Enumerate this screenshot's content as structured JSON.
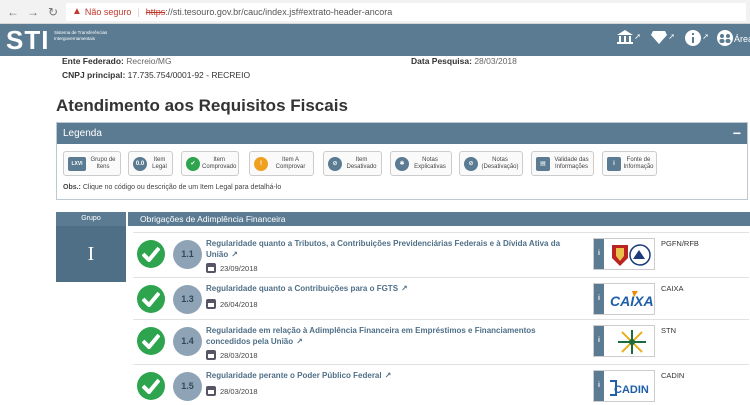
{
  "browser": {
    "security_label": "Não seguro",
    "url_scheme": "https",
    "url_rest": "://sti.tesouro.gov.br/cauc/index.jsf#extrato-header-ancora"
  },
  "app": {
    "logo": "STI",
    "logo_sub": "Sistema de Transferências Intergovernamentais",
    "area_label": "Área"
  },
  "entity": {
    "ente_label": "Ente Federado:",
    "ente_value": "Recreio/MG",
    "data_label": "Data Pesquisa:",
    "data_value": "28/03/2018",
    "cnpj_label": "CNPJ principal:",
    "cnpj_value": "17.735.754/0001-92 - RECREIO"
  },
  "page_title": "Atendimento aos Requisitos Fiscais",
  "legend": {
    "title": "Legenda",
    "collapse": "−",
    "items": [
      {
        "icon": "LXVI",
        "label": "Grupo de Itens",
        "color": "#5b7b92"
      },
      {
        "icon": "0.0",
        "label": "Item Legal",
        "color": "#5b7b92"
      },
      {
        "icon": "✔",
        "label": "Item Comprovado",
        "color": "#2fa44f"
      },
      {
        "icon": "!",
        "label": "Item A Comprovar",
        "color": "#f0a020"
      },
      {
        "icon": "⊘",
        "label": "Item Desativado",
        "color": "#5b7b92"
      },
      {
        "icon": "✱",
        "label": "Notas Explicativas",
        "color": "#5b7b92"
      },
      {
        "icon": "⊘",
        "label": "Notas (Desativação)",
        "color": "#5b7b92"
      },
      {
        "icon": "▤",
        "label": "Validade das Informações",
        "color": "#5b7b92"
      },
      {
        "icon": "i",
        "label": "Fonte de Informação",
        "color": "#5b7b92"
      }
    ],
    "obs_label": "Obs.:",
    "obs_text": "Clique no código ou descrição de um Item Legal para detalhá-lo"
  },
  "grupo": {
    "header": "Grupo",
    "value": "I",
    "section_title": "Obrigações de Adimplência Financeira"
  },
  "rows": [
    {
      "code": "1.1",
      "title": "Regularidade quanto a Tributos, a Contribuições Previdenciárias Federais e à Dívida Ativa da União",
      "date": "23/09/2018",
      "source": "PGFN/RFB",
      "status_color": "#2fa44f"
    },
    {
      "code": "1.3",
      "title": "Regularidade quanto a Contribuições para o FGTS",
      "date": "26/04/2018",
      "source": "CAIXA",
      "status_color": "#2fa44f"
    },
    {
      "code": "1.4",
      "title": "Regularidade em relação à Adimplência Financeira em Empréstimos e Financiamentos concedidos pela União",
      "date": "28/03/2018",
      "source": "STN",
      "status_color": "#2fa44f"
    },
    {
      "code": "1.5",
      "title": "Regularidade perante o Poder Público Federal",
      "date": "28/03/2018",
      "source": "CADIN",
      "status_color": "#2fa44f"
    }
  ]
}
